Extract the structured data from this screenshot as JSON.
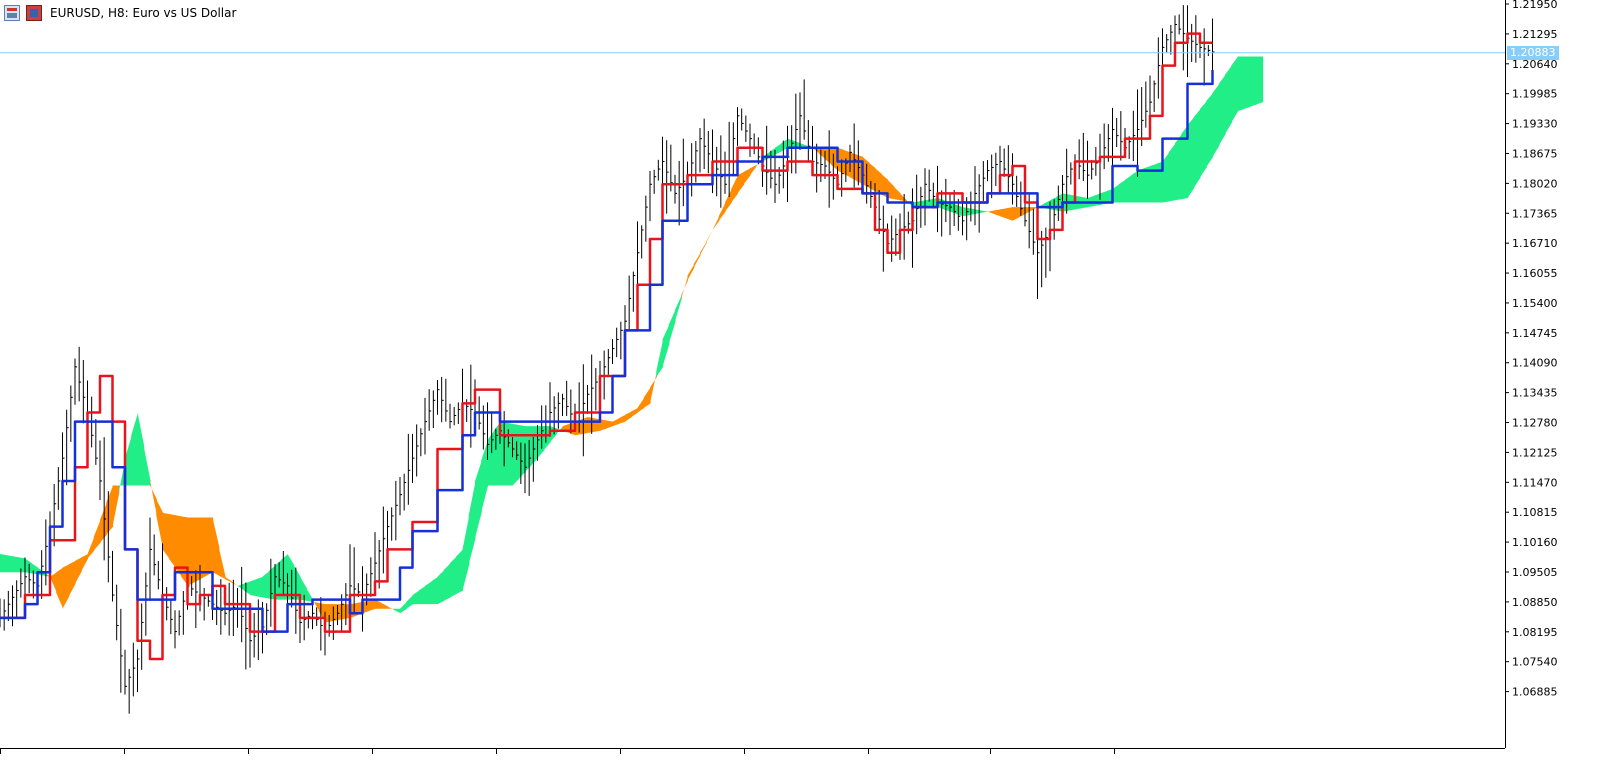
{
  "window": {
    "title": "EURUSD, H8:  Euro vs US Dollar",
    "icons": [
      "chart-window-icon",
      "symbol-flag-icon"
    ]
  },
  "colors": {
    "candles": "#000000",
    "tenkan": "#e8141c",
    "kijun": "#1530d8",
    "cloud_bearish": "#ff8c00",
    "cloud_bullish": "#22ee88",
    "current_price_line": "#87cefa",
    "axis": "#000000"
  },
  "chart_data": {
    "type": "line",
    "title": "EURUSD, H8:  Euro vs US Dollar",
    "ylim": [
      1.0635,
      1.2195
    ],
    "y_ticks": [
      "1.21950",
      "1.21295",
      "1.20640",
      "1.19985",
      "1.19330",
      "1.18675",
      "1.18020",
      "1.17365",
      "1.16710",
      "1.16055",
      "1.15400",
      "1.14745",
      "1.14090",
      "1.13435",
      "1.12780",
      "1.12125",
      "1.11470",
      "1.10815",
      "1.10160",
      "1.09505",
      "1.08850",
      "1.08195",
      "1.07540",
      "1.06885"
    ],
    "current_price": "1.20883",
    "grid": false,
    "x_count": 97,
    "x_last_bar": 97,
    "series": [
      {
        "key": "tenkan",
        "color": "#e8141c",
        "points": [
          [
            0,
            1.085
          ],
          [
            2,
            1.09
          ],
          [
            4,
            1.102
          ],
          [
            6,
            1.118
          ],
          [
            7,
            1.13
          ],
          [
            8,
            1.138
          ],
          [
            9,
            1.128
          ],
          [
            10,
            1.1
          ],
          [
            11,
            1.08
          ],
          [
            12,
            1.076
          ],
          [
            13,
            1.09
          ],
          [
            14,
            1.096
          ],
          [
            15,
            1.088
          ],
          [
            16,
            1.09
          ],
          [
            17,
            1.092
          ],
          [
            18,
            1.088
          ],
          [
            20,
            1.082
          ],
          [
            22,
            1.09
          ],
          [
            24,
            1.085
          ],
          [
            26,
            1.082
          ],
          [
            28,
            1.09
          ],
          [
            30,
            1.093
          ],
          [
            31,
            1.1
          ],
          [
            33,
            1.106
          ],
          [
            35,
            1.122
          ],
          [
            37,
            1.132
          ],
          [
            38,
            1.135
          ],
          [
            40,
            1.125
          ],
          [
            42,
            1.125
          ],
          [
            44,
            1.126
          ],
          [
            46,
            1.13
          ],
          [
            48,
            1.138
          ],
          [
            50,
            1.148
          ],
          [
            51,
            1.158
          ],
          [
            52,
            1.168
          ],
          [
            53,
            1.18
          ],
          [
            55,
            1.182
          ],
          [
            57,
            1.185
          ],
          [
            59,
            1.188
          ],
          [
            61,
            1.183
          ],
          [
            63,
            1.185
          ],
          [
            65,
            1.182
          ],
          [
            67,
            1.179
          ],
          [
            69,
            1.178
          ],
          [
            70,
            1.17
          ],
          [
            71,
            1.165
          ],
          [
            72,
            1.17
          ],
          [
            73,
            1.175
          ],
          [
            75,
            1.178
          ],
          [
            77,
            1.176
          ],
          [
            79,
            1.178
          ],
          [
            80,
            1.182
          ],
          [
            81,
            1.184
          ],
          [
            82,
            1.176
          ],
          [
            83,
            1.168
          ],
          [
            84,
            1.17
          ],
          [
            85,
            1.176
          ],
          [
            86,
            1.185
          ],
          [
            88,
            1.186
          ],
          [
            90,
            1.19
          ],
          [
            92,
            1.195
          ],
          [
            93,
            1.206
          ],
          [
            94,
            1.211
          ],
          [
            95,
            1.213
          ],
          [
            96,
            1.211
          ],
          [
            97,
            1.211
          ]
        ]
      },
      {
        "key": "kijun",
        "color": "#1530d8",
        "points": [
          [
            0,
            1.085
          ],
          [
            2,
            1.088
          ],
          [
            3,
            1.095
          ],
          [
            4,
            1.105
          ],
          [
            5,
            1.115
          ],
          [
            6,
            1.128
          ],
          [
            8,
            1.128
          ],
          [
            9,
            1.118
          ],
          [
            10,
            1.1
          ],
          [
            11,
            1.089
          ],
          [
            13,
            1.089
          ],
          [
            14,
            1.095
          ],
          [
            16,
            1.095
          ],
          [
            17,
            1.087
          ],
          [
            19,
            1.087
          ],
          [
            21,
            1.082
          ],
          [
            23,
            1.088
          ],
          [
            25,
            1.089
          ],
          [
            27,
            1.089
          ],
          [
            28,
            1.086
          ],
          [
            29,
            1.089
          ],
          [
            31,
            1.089
          ],
          [
            32,
            1.096
          ],
          [
            33,
            1.104
          ],
          [
            35,
            1.113
          ],
          [
            37,
            1.125
          ],
          [
            38,
            1.13
          ],
          [
            40,
            1.128
          ],
          [
            42,
            1.128
          ],
          [
            44,
            1.128
          ],
          [
            46,
            1.128
          ],
          [
            48,
            1.13
          ],
          [
            49,
            1.138
          ],
          [
            50,
            1.148
          ],
          [
            52,
            1.158
          ],
          [
            53,
            1.172
          ],
          [
            55,
            1.18
          ],
          [
            57,
            1.182
          ],
          [
            59,
            1.185
          ],
          [
            61,
            1.186
          ],
          [
            63,
            1.188
          ],
          [
            65,
            1.188
          ],
          [
            67,
            1.185
          ],
          [
            69,
            1.178
          ],
          [
            71,
            1.176
          ],
          [
            73,
            1.175
          ],
          [
            75,
            1.176
          ],
          [
            77,
            1.176
          ],
          [
            79,
            1.178
          ],
          [
            81,
            1.178
          ],
          [
            83,
            1.175
          ],
          [
            85,
            1.176
          ],
          [
            87,
            1.176
          ],
          [
            89,
            1.184
          ],
          [
            91,
            1.183
          ],
          [
            93,
            1.19
          ],
          [
            95,
            1.202
          ],
          [
            97,
            1.205
          ]
        ]
      }
    ],
    "cloud": {
      "span_a": [
        [
          0,
          1.099
        ],
        [
          2,
          1.098
        ],
        [
          4,
          1.094
        ],
        [
          5,
          1.087
        ],
        [
          7,
          1.098
        ],
        [
          9,
          1.105
        ],
        [
          10,
          1.12
        ],
        [
          11,
          1.13
        ],
        [
          12,
          1.115
        ],
        [
          13,
          1.1
        ],
        [
          15,
          1.092
        ],
        [
          17,
          1.095
        ],
        [
          19,
          1.092
        ],
        [
          21,
          1.094
        ],
        [
          23,
          1.099
        ],
        [
          24,
          1.094
        ],
        [
          26,
          1.084
        ],
        [
          28,
          1.085
        ],
        [
          30,
          1.087
        ],
        [
          32,
          1.087
        ],
        [
          33,
          1.09
        ],
        [
          35,
          1.094
        ],
        [
          37,
          1.1
        ],
        [
          38,
          1.115
        ],
        [
          39,
          1.124
        ],
        [
          40,
          1.128
        ],
        [
          42,
          1.127
        ],
        [
          44,
          1.127
        ],
        [
          46,
          1.125
        ],
        [
          48,
          1.126
        ],
        [
          50,
          1.128
        ],
        [
          52,
          1.132
        ],
        [
          53,
          1.146
        ],
        [
          55,
          1.159
        ],
        [
          57,
          1.17
        ],
        [
          59,
          1.178
        ],
        [
          61,
          1.186
        ],
        [
          63,
          1.19
        ],
        [
          65,
          1.188
        ],
        [
          67,
          1.183
        ],
        [
          69,
          1.18
        ],
        [
          71,
          1.177
        ],
        [
          73,
          1.176
        ],
        [
          75,
          1.177
        ],
        [
          77,
          1.175
        ],
        [
          79,
          1.174
        ],
        [
          81,
          1.172
        ],
        [
          83,
          1.175
        ],
        [
          85,
          1.178
        ],
        [
          87,
          1.177
        ],
        [
          89,
          1.179
        ],
        [
          91,
          1.183
        ],
        [
          93,
          1.185
        ],
        [
          95,
          1.193
        ],
        [
          97,
          1.2
        ],
        [
          99,
          1.208
        ],
        [
          101,
          1.208
        ]
      ],
      "span_b": [
        [
          0,
          1.095
        ],
        [
          2,
          1.095
        ],
        [
          4,
          1.094
        ],
        [
          5,
          1.096
        ],
        [
          7,
          1.099
        ],
        [
          9,
          1.114
        ],
        [
          11,
          1.114
        ],
        [
          12,
          1.114
        ],
        [
          13,
          1.108
        ],
        [
          15,
          1.107
        ],
        [
          17,
          1.107
        ],
        [
          18,
          1.094
        ],
        [
          20,
          1.09
        ],
        [
          22,
          1.089
        ],
        [
          24,
          1.089
        ],
        [
          26,
          1.088
        ],
        [
          28,
          1.088
        ],
        [
          30,
          1.089
        ],
        [
          32,
          1.086
        ],
        [
          33,
          1.088
        ],
        [
          35,
          1.088
        ],
        [
          37,
          1.091
        ],
        [
          39,
          1.114
        ],
        [
          41,
          1.114
        ],
        [
          43,
          1.12
        ],
        [
          45,
          1.127
        ],
        [
          47,
          1.129
        ],
        [
          49,
          1.128
        ],
        [
          51,
          1.131
        ],
        [
          53,
          1.14
        ],
        [
          55,
          1.16
        ],
        [
          57,
          1.17
        ],
        [
          59,
          1.182
        ],
        [
          61,
          1.185
        ],
        [
          63,
          1.188
        ],
        [
          65,
          1.188
        ],
        [
          67,
          1.188
        ],
        [
          69,
          1.186
        ],
        [
          71,
          1.181
        ],
        [
          73,
          1.175
        ],
        [
          75,
          1.175
        ],
        [
          77,
          1.173
        ],
        [
          79,
          1.174
        ],
        [
          81,
          1.175
        ],
        [
          83,
          1.175
        ],
        [
          85,
          1.174
        ],
        [
          87,
          1.175
        ],
        [
          89,
          1.176
        ],
        [
          91,
          1.176
        ],
        [
          93,
          1.176
        ],
        [
          95,
          1.177
        ],
        [
          97,
          1.186
        ],
        [
          99,
          1.196
        ],
        [
          101,
          1.198
        ]
      ]
    },
    "price_path": [
      [
        0,
        1.085
      ],
      [
        2,
        1.094
      ],
      [
        3,
        1.092
      ],
      [
        4,
        1.105
      ],
      [
        5,
        1.12
      ],
      [
        6,
        1.14
      ],
      [
        7,
        1.13
      ],
      [
        8,
        1.115
      ],
      [
        9,
        1.09
      ],
      [
        10,
        1.07
      ],
      [
        11,
        1.076
      ],
      [
        12,
        1.1
      ],
      [
        13,
        1.09
      ],
      [
        14,
        1.082
      ],
      [
        15,
        1.092
      ],
      [
        16,
        1.09
      ],
      [
        17,
        1.088
      ],
      [
        18,
        1.086
      ],
      [
        19,
        1.088
      ],
      [
        20,
        1.08
      ],
      [
        21,
        1.083
      ],
      [
        22,
        1.094
      ],
      [
        23,
        1.092
      ],
      [
        24,
        1.084
      ],
      [
        25,
        1.086
      ],
      [
        26,
        1.082
      ],
      [
        27,
        1.086
      ],
      [
        28,
        1.092
      ],
      [
        29,
        1.09
      ],
      [
        30,
        1.097
      ],
      [
        31,
        1.105
      ],
      [
        32,
        1.112
      ],
      [
        33,
        1.12
      ],
      [
        34,
        1.128
      ],
      [
        35,
        1.135
      ],
      [
        36,
        1.128
      ],
      [
        37,
        1.132
      ],
      [
        38,
        1.13
      ],
      [
        39,
        1.123
      ],
      [
        40,
        1.126
      ],
      [
        41,
        1.122
      ],
      [
        42,
        1.118
      ],
      [
        43,
        1.124
      ],
      [
        44,
        1.13
      ],
      [
        45,
        1.133
      ],
      [
        46,
        1.128
      ],
      [
        47,
        1.134
      ],
      [
        48,
        1.138
      ],
      [
        49,
        1.144
      ],
      [
        50,
        1.15
      ],
      [
        51,
        1.165
      ],
      [
        52,
        1.18
      ],
      [
        53,
        1.185
      ],
      [
        54,
        1.178
      ],
      [
        55,
        1.182
      ],
      [
        56,
        1.19
      ],
      [
        57,
        1.185
      ],
      [
        58,
        1.18
      ],
      [
        59,
        1.195
      ],
      [
        60,
        1.19
      ],
      [
        61,
        1.184
      ],
      [
        62,
        1.18
      ],
      [
        63,
        1.186
      ],
      [
        64,
        1.195
      ],
      [
        65,
        1.185
      ],
      [
        66,
        1.184
      ],
      [
        67,
        1.18
      ],
      [
        68,
        1.187
      ],
      [
        69,
        1.182
      ],
      [
        70,
        1.175
      ],
      [
        71,
        1.167
      ],
      [
        72,
        1.17
      ],
      [
        73,
        1.172
      ],
      [
        74,
        1.18
      ],
      [
        75,
        1.176
      ],
      [
        76,
        1.175
      ],
      [
        77,
        1.172
      ],
      [
        78,
        1.178
      ],
      [
        79,
        1.183
      ],
      [
        80,
        1.185
      ],
      [
        81,
        1.18
      ],
      [
        82,
        1.172
      ],
      [
        83,
        1.165
      ],
      [
        84,
        1.17
      ],
      [
        85,
        1.18
      ],
      [
        86,
        1.185
      ],
      [
        87,
        1.182
      ],
      [
        88,
        1.186
      ],
      [
        89,
        1.192
      ],
      [
        90,
        1.188
      ],
      [
        91,
        1.192
      ],
      [
        92,
        1.198
      ],
      [
        93,
        1.21
      ],
      [
        94,
        1.215
      ],
      [
        95,
        1.212
      ],
      [
        96,
        1.21
      ],
      [
        97,
        1.209
      ]
    ]
  }
}
